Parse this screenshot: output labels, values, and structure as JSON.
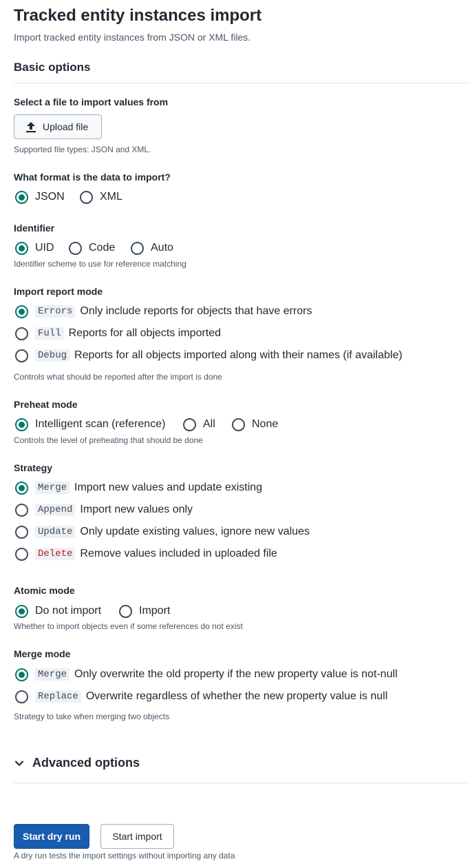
{
  "page": {
    "title": "Tracked entity instances import",
    "subtitle": "Import tracked entity instances from JSON or XML files."
  },
  "basic": {
    "heading": "Basic options"
  },
  "file": {
    "label": "Select a file to import values from",
    "button": "Upload file",
    "help": "Supported file types: JSON and XML.",
    "icon": "upload-icon"
  },
  "format": {
    "label": "What format is the data to import?",
    "options": [
      "JSON",
      "XML"
    ],
    "selected": "JSON"
  },
  "identifier": {
    "label": "Identifier",
    "options": [
      "UID",
      "Code",
      "Auto"
    ],
    "selected": "UID",
    "help": "Identifier scheme to use for reference matching"
  },
  "report": {
    "label": "Import report mode",
    "options": [
      {
        "code": "Errors",
        "text": "Only include reports for objects that have errors"
      },
      {
        "code": "Full",
        "text": "Reports for all objects imported"
      },
      {
        "code": "Debug",
        "text": "Reports for all objects imported along with their names (if available)"
      }
    ],
    "selected": "Errors",
    "help": "Controls what should be reported after the import is done"
  },
  "preheat": {
    "label": "Preheat mode",
    "options": [
      "Intelligent scan (reference)",
      "All",
      "None"
    ],
    "selected": "Intelligent scan (reference)",
    "help": "Controls the level of preheating that should be done"
  },
  "strategy": {
    "label": "Strategy",
    "options": [
      {
        "code": "Merge",
        "text": "Import new values and update existing"
      },
      {
        "code": "Append",
        "text": "Import new values only"
      },
      {
        "code": "Update",
        "text": "Only update existing values, ignore new values"
      },
      {
        "code": "Delete",
        "text": "Remove values included in uploaded file"
      }
    ],
    "selected": "Merge",
    "delete_color": "#b71c1c"
  },
  "atomic": {
    "label": "Atomic mode",
    "options": [
      "Do not import",
      "Import"
    ],
    "selected": "Do not import",
    "help": "Whether to import objects even if some references do not exist"
  },
  "merge": {
    "label": "Merge mode",
    "options": [
      {
        "code": "Merge",
        "text": "Only overwrite the old property if the new property value is not-null"
      },
      {
        "code": "Replace",
        "text": "Overwrite regardless of whether the new property value is null"
      }
    ],
    "selected": "Merge",
    "help": "Strategy to take when merging two objects"
  },
  "advanced": {
    "label": "Advanced options",
    "icon": "chevron-down-icon"
  },
  "actions": {
    "dry_run": "Start dry run",
    "import": "Start import",
    "help": "A dry run tests the import settings without importing any data"
  },
  "colors": {
    "accent": "#00796b",
    "primary": "#1a5db0"
  }
}
